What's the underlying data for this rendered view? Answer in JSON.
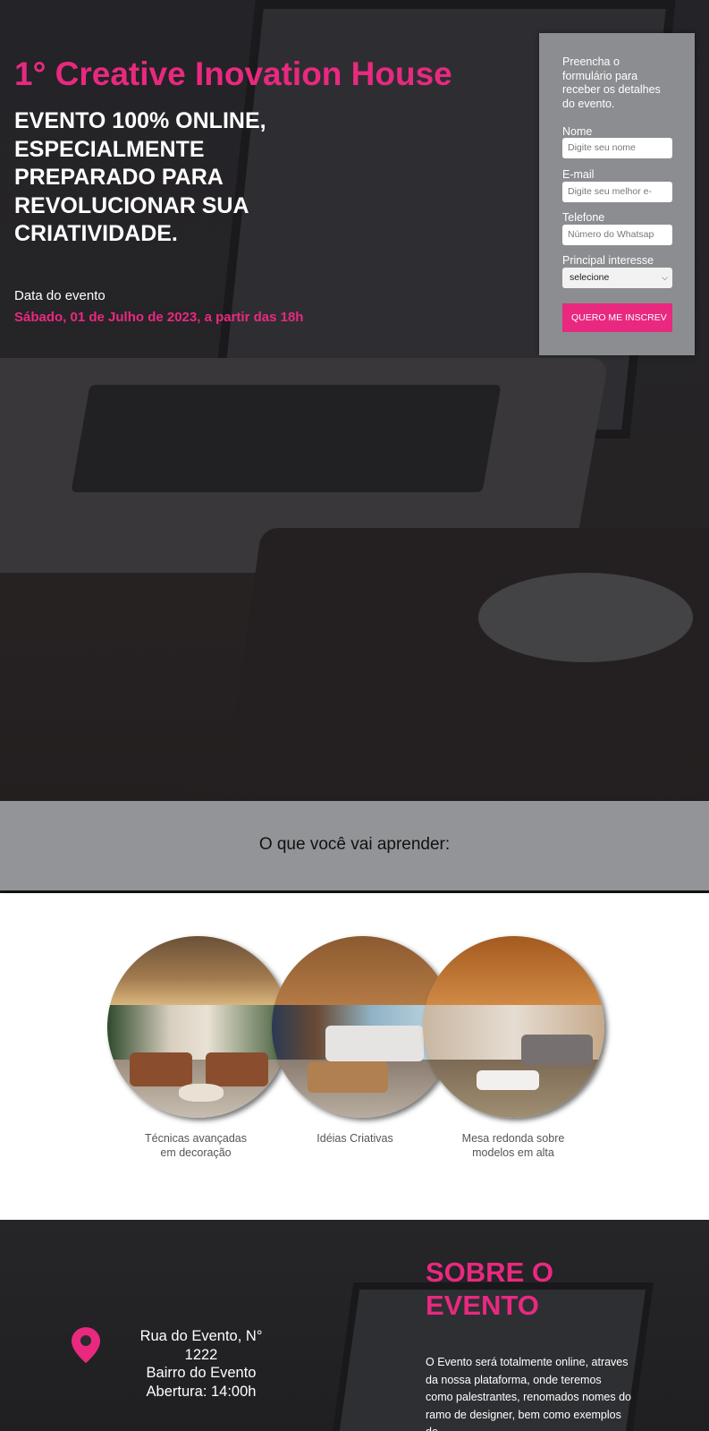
{
  "hero": {
    "title": "1° Creative Inovation House",
    "subtitle": "EVENTO 100% ONLINE, ESPECIALMENTE PREPARADO PARA REVOLUCIONAR SUA CRIATIVIDADE.",
    "date_label": "Data do evento",
    "date_value": "Sábado, 01 de Julho de 2023, a partir das 18h"
  },
  "form": {
    "intro": "Preencha o formulário para receber os detalhes do evento.",
    "name_label": "Nome",
    "name_placeholder": "Digite seu nome",
    "email_label": "E-mail",
    "email_placeholder": "Digite seu melhor e-",
    "phone_label": "Telefone",
    "phone_placeholder": "Número do Whatsap",
    "interest_label": "Principal interesse",
    "interest_selected": "selecione",
    "submit_label": "QUERO ME INSCREV"
  },
  "learn": {
    "title": "O que você vai aprender:",
    "items": [
      {
        "caption": "Técnicas avançadas em decoração"
      },
      {
        "caption": "Idéias Criativas"
      },
      {
        "caption": "Mesa redonda sobre modelos em alta"
      }
    ]
  },
  "about": {
    "title": "SOBRE O EVENTO",
    "text": "O Evento será totalmente online, atraves da nossa plataforma, onde teremos como palestrantes, renomados nomes do ramo de designer, bem como exemplos de",
    "address": "Rua do Evento, N° 1222\nBairro do Evento\nAbertura: 14:00h",
    "pin_icon": "map-pin-icon",
    "accent": "#e8297f"
  }
}
